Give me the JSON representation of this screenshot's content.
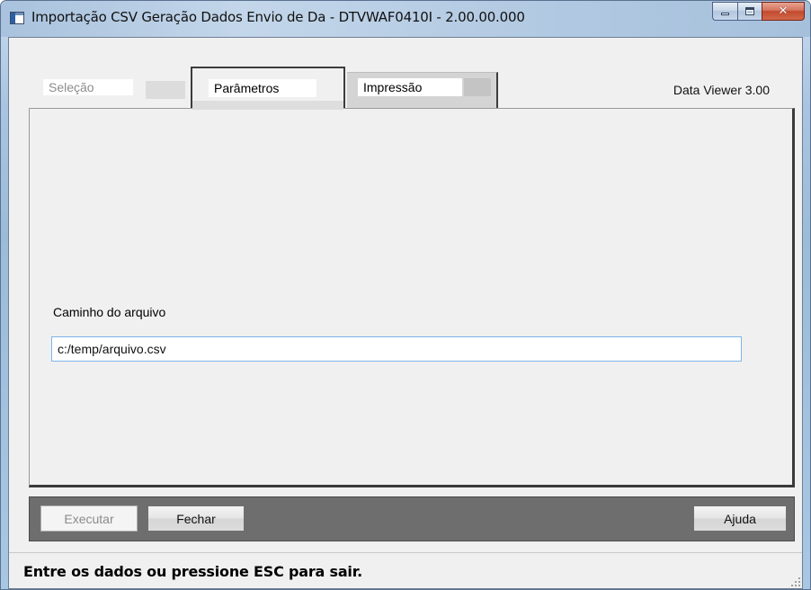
{
  "window": {
    "title": "Importação CSV Geração Dados Envio de Da - DTVWAF0410I - 2.00.00.000",
    "icons": {
      "app": "window-app-icon",
      "minimize": "minimize-icon",
      "maximize": "maximize-icon",
      "close": "close-icon"
    }
  },
  "tabs": [
    {
      "label": "Seleção",
      "state": "disabled"
    },
    {
      "label": "Parâmetros",
      "state": "active"
    },
    {
      "label": "Impressão",
      "state": "inactive"
    }
  ],
  "data_viewer": "Data Viewer 3.00",
  "parameters": {
    "path_label": "Caminho do arquivo",
    "path_value": "c:/temp/arquivo.csv"
  },
  "buttons": {
    "execute": "Executar",
    "close": "Fechar",
    "help": "Ajuda"
  },
  "status": {
    "message": "Entre os dados ou pressione ESC para sair."
  }
}
